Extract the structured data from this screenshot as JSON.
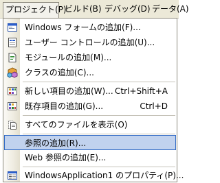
{
  "menubar": {
    "items": [
      {
        "label": "プロジェクト(P)"
      },
      {
        "label": "ビルド(B)"
      },
      {
        "label": "デバッグ(D)"
      },
      {
        "label": "データ(A)"
      }
    ]
  },
  "menu": {
    "items": [
      {
        "label": "Windows フォームの追加(F)...",
        "icon": "windows-form-icon"
      },
      {
        "label": "ユーザー コントロールの追加(U)...",
        "icon": "user-control-icon"
      },
      {
        "label": "モジュールの追加(M)...",
        "icon": "module-icon"
      },
      {
        "label": "クラスの追加(C)...",
        "icon": "class-icon"
      },
      {
        "label": "新しい項目の追加(W)...",
        "shortcut": "Ctrl+Shift+A",
        "icon": "new-item-icon"
      },
      {
        "label": "既存項目の追加(G)...",
        "shortcut": "Ctrl+D",
        "icon": "existing-item-icon"
      },
      {
        "label": "すべてのファイルを表示(O)",
        "icon": "show-all-files-icon"
      },
      {
        "label": "参照の追加(R)...",
        "icon": ""
      },
      {
        "label": "Web 参照の追加(E)...",
        "icon": ""
      },
      {
        "label": "WindowsApplication1 のプロパティ(P)...",
        "icon": "properties-icon"
      }
    ]
  },
  "colors": {
    "highlight_fill": "#c1d2ee",
    "highlight_border": "#316ac5",
    "menubar_bg": "#ece9d8"
  }
}
